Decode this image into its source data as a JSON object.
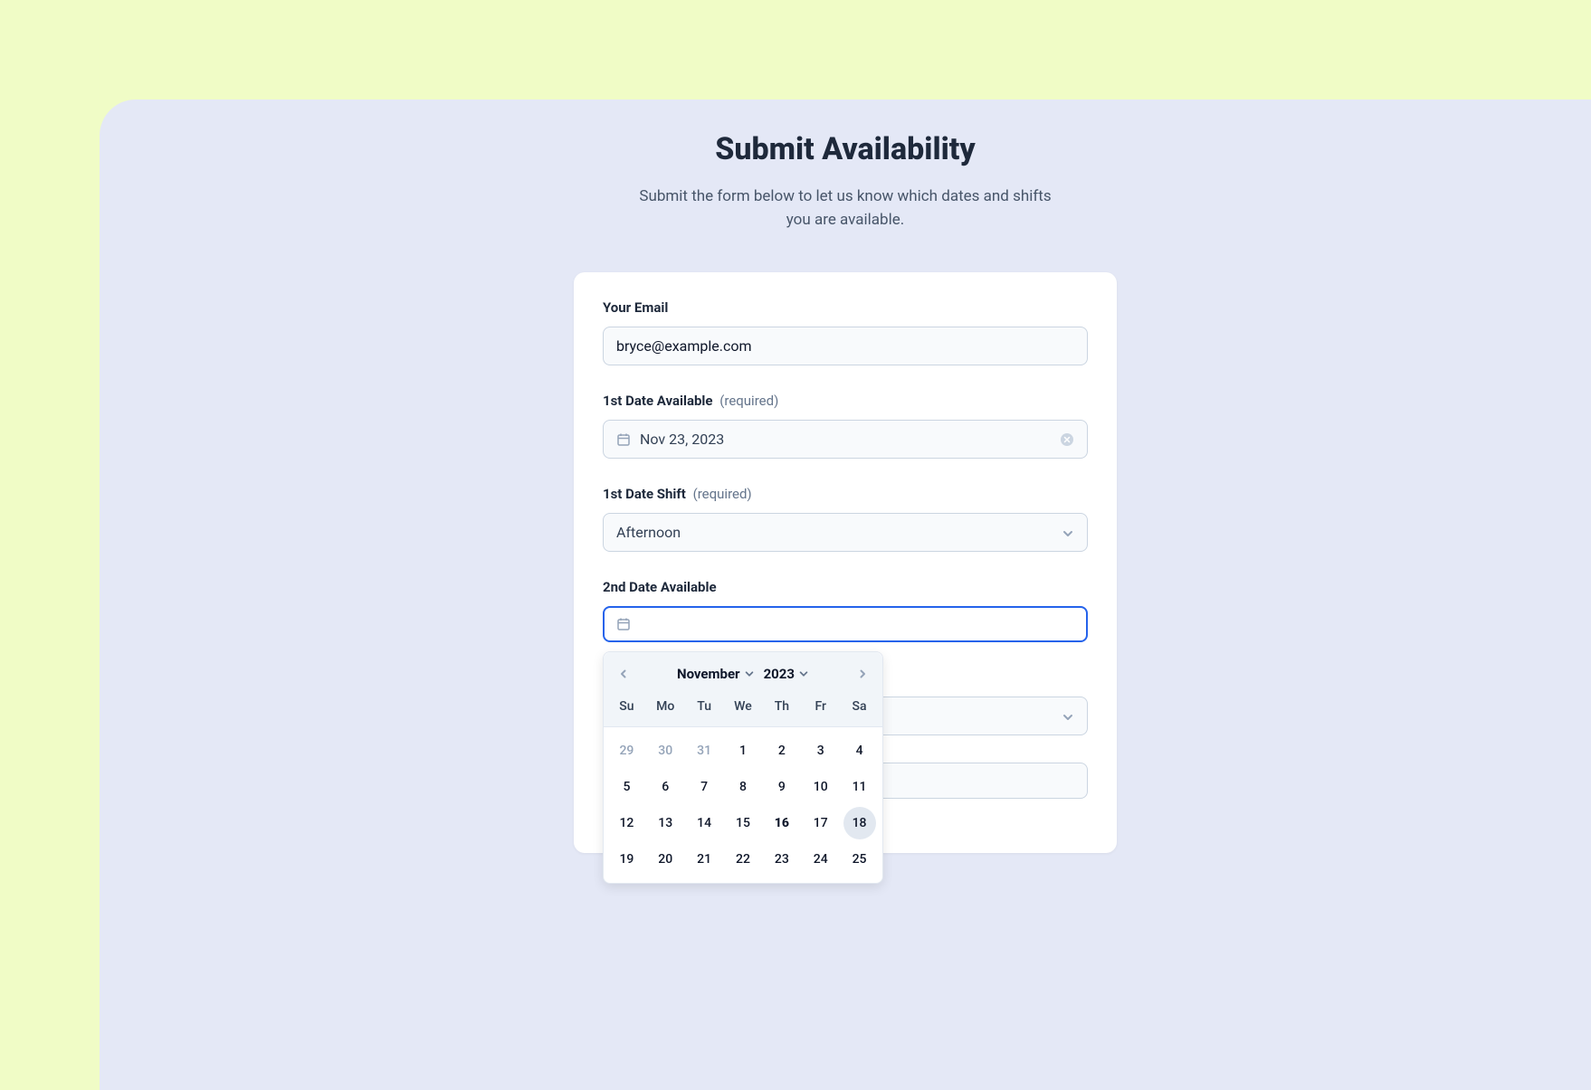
{
  "header": {
    "title": "Submit Availability",
    "subtitle": "Submit the form below to let us know which dates and shifts you are available."
  },
  "form": {
    "email": {
      "label": "Your Email",
      "value": "bryce@example.com"
    },
    "date1": {
      "label": "1st Date Available",
      "hint": "(required)",
      "value": "Nov 23, 2023"
    },
    "shift1": {
      "label": "1st Date Shift",
      "hint": "(required)",
      "value": "Afternoon"
    },
    "date2": {
      "label": "2nd Date Available",
      "value": ""
    }
  },
  "calendar": {
    "month": "November",
    "year": "2023",
    "weekdays": [
      "Su",
      "Mo",
      "Tu",
      "We",
      "Th",
      "Fr",
      "Sa"
    ],
    "days": [
      {
        "num": "29",
        "otherMonth": true
      },
      {
        "num": "30",
        "otherMonth": true
      },
      {
        "num": "31",
        "otherMonth": true
      },
      {
        "num": "1"
      },
      {
        "num": "2"
      },
      {
        "num": "3"
      },
      {
        "num": "4"
      },
      {
        "num": "5"
      },
      {
        "num": "6"
      },
      {
        "num": "7"
      },
      {
        "num": "8"
      },
      {
        "num": "9"
      },
      {
        "num": "10"
      },
      {
        "num": "11"
      },
      {
        "num": "12"
      },
      {
        "num": "13"
      },
      {
        "num": "14"
      },
      {
        "num": "15"
      },
      {
        "num": "16",
        "today": true
      },
      {
        "num": "17"
      },
      {
        "num": "18",
        "hovered": true
      },
      {
        "num": "19"
      },
      {
        "num": "20"
      },
      {
        "num": "21"
      },
      {
        "num": "22"
      },
      {
        "num": "23"
      },
      {
        "num": "24"
      },
      {
        "num": "25"
      }
    ]
  }
}
